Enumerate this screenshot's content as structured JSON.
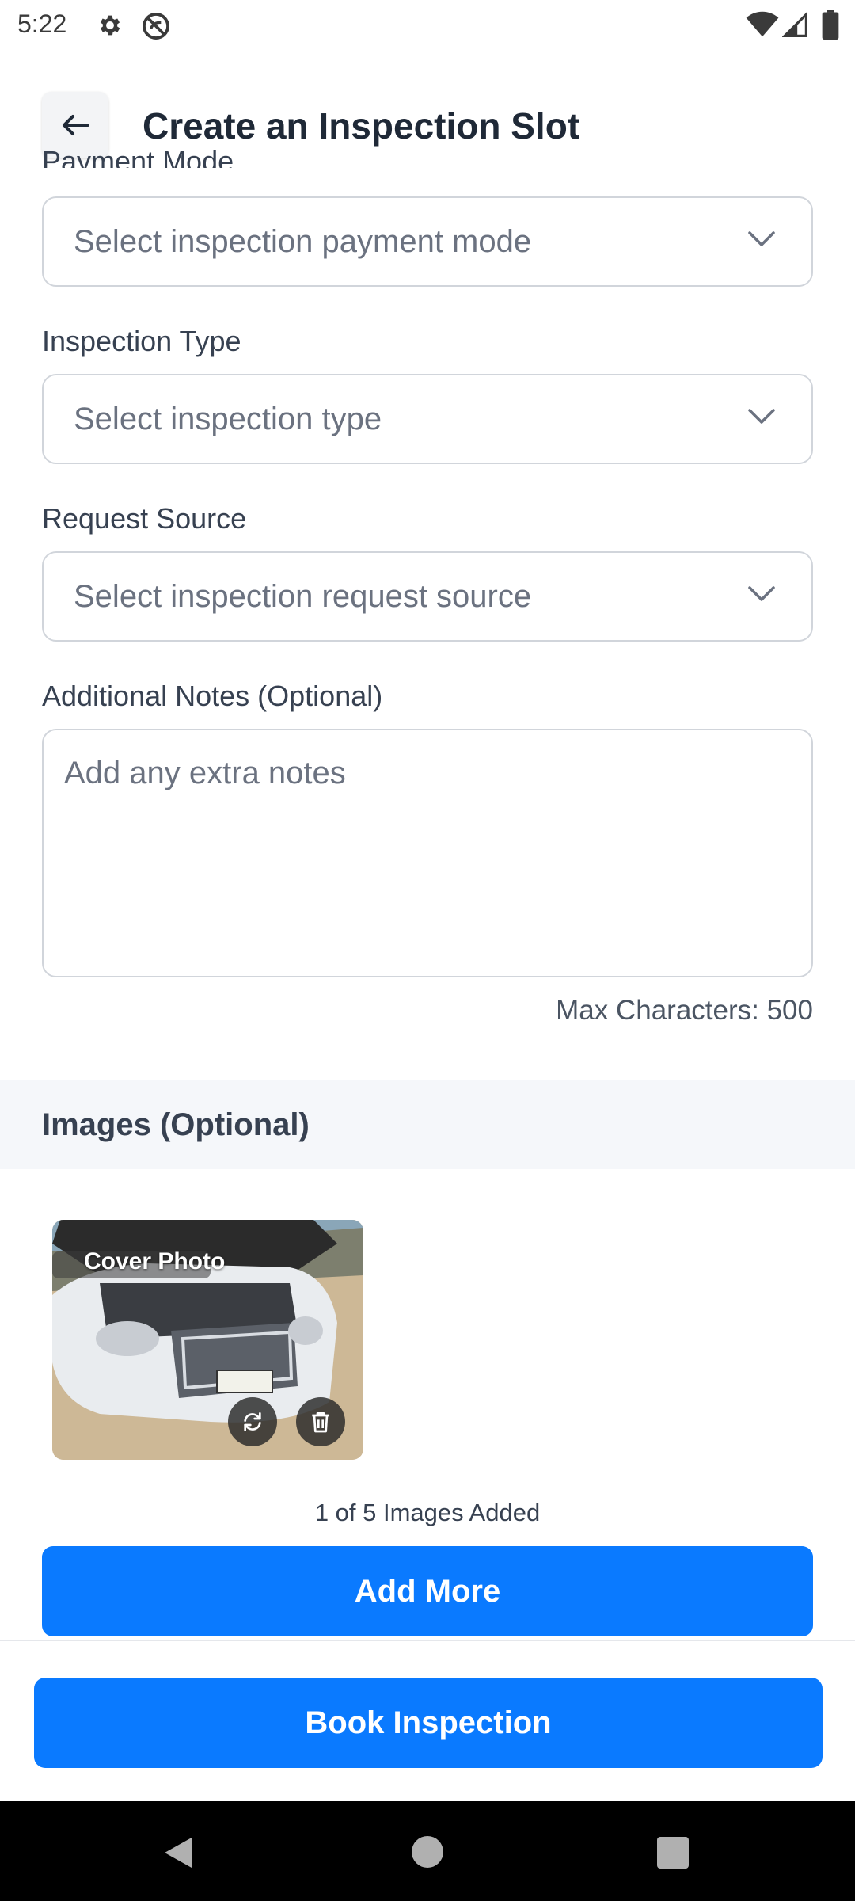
{
  "status_bar": {
    "time": "5:22"
  },
  "header": {
    "title": "Create an Inspection Slot"
  },
  "form": {
    "payment_mode": {
      "label": "Payment Mode",
      "placeholder": "Select inspection payment mode"
    },
    "inspection_type": {
      "label": "Inspection Type",
      "placeholder": "Select inspection type"
    },
    "request_source": {
      "label": "Request Source",
      "placeholder": "Select inspection request source"
    },
    "notes": {
      "label": "Additional Notes (Optional)",
      "placeholder": "Add any extra notes",
      "max_chars": "Max Characters: 500"
    }
  },
  "images": {
    "title": "Images (Optional)",
    "cover_label": "Cover Photo",
    "count_text": "1 of 5 Images Added",
    "add_more": "Add More"
  },
  "actions": {
    "book": "Book Inspection"
  },
  "icons": {
    "status": [
      "gear-icon",
      "do-not-disturb-icon",
      "wifi-icon",
      "signal-icon",
      "battery-icon"
    ],
    "back": "arrow-left-icon",
    "chevron": "chevron-down-icon",
    "photo_actions": [
      "replace-icon",
      "trash-icon"
    ],
    "nav": [
      "nav-back-icon",
      "nav-home-icon",
      "nav-recents-icon"
    ]
  },
  "colors": {
    "primary": "#0a7aff",
    "border": "#d1d5db",
    "text": "#1f2937",
    "muted": "#6b7280",
    "section_bg": "#f5f7fa"
  }
}
